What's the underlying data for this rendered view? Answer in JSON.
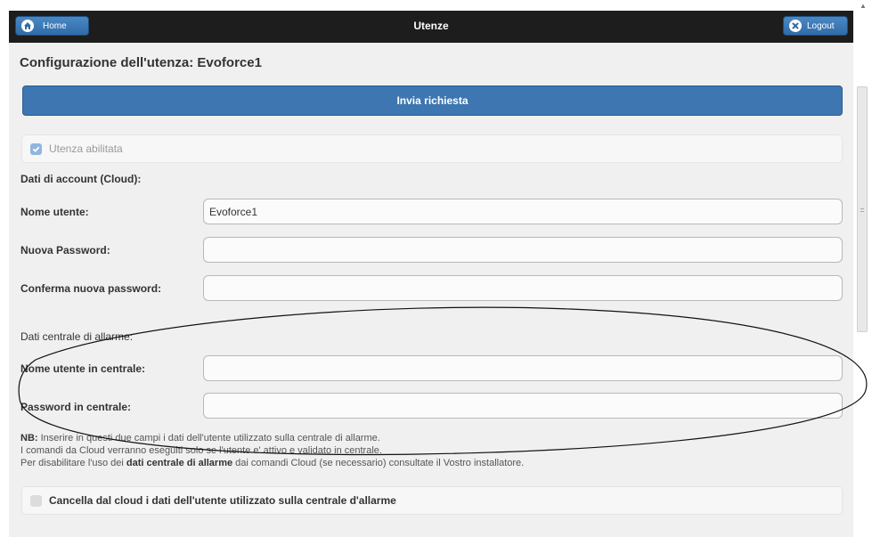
{
  "header": {
    "home_label": "Home",
    "title": "Utenze",
    "logout_label": "Logout"
  },
  "page_title": "Configurazione dell'utenza: Evoforce1",
  "send_button_label": "Invia richiesta",
  "enabled_checkbox": {
    "label": "Utenza abilitata",
    "checked": true
  },
  "cloud_section_label": "Dati di account (Cloud):",
  "fields": {
    "username": {
      "label": "Nome utente:",
      "value": "Evoforce1"
    },
    "new_password": {
      "label": "Nuova Password:",
      "value": ""
    },
    "confirm_password": {
      "label": "Conferma nuova password:",
      "value": ""
    }
  },
  "alarm_section_label": "Dati centrale di allarme:",
  "alarm_fields": {
    "panel_username": {
      "label": "Nome utente in centrale:",
      "value": ""
    },
    "panel_password": {
      "label": "Password in centrale:",
      "value": ""
    }
  },
  "note": {
    "nb_prefix": "NB:",
    "line1": "Inserire in questi due campi i dati dell'utente utilizzato sulla centrale di allarme.",
    "line2": "I comandi da Cloud verranno eseguiti solo se l'utente e' attivo e validato in centrale.",
    "line3_a": "Per disabilitare l'uso dei",
    "line3_bold": "dati centrale di allarme",
    "line3_b": "dai comandi Cloud (se necessario) consultate il Vostro installatore."
  },
  "delete_checkbox": {
    "label": "Cancella dal cloud i dati dell'utente utilizzato sulla centrale d'allarme",
    "checked": false
  },
  "icons": {
    "home": "home-icon",
    "logout": "close-icon",
    "checkbox_check": "check-icon"
  },
  "colors": {
    "header_bg": "#1d1d1d",
    "button_blue": "#3d76b0",
    "page_bg": "#f0f0f0"
  }
}
